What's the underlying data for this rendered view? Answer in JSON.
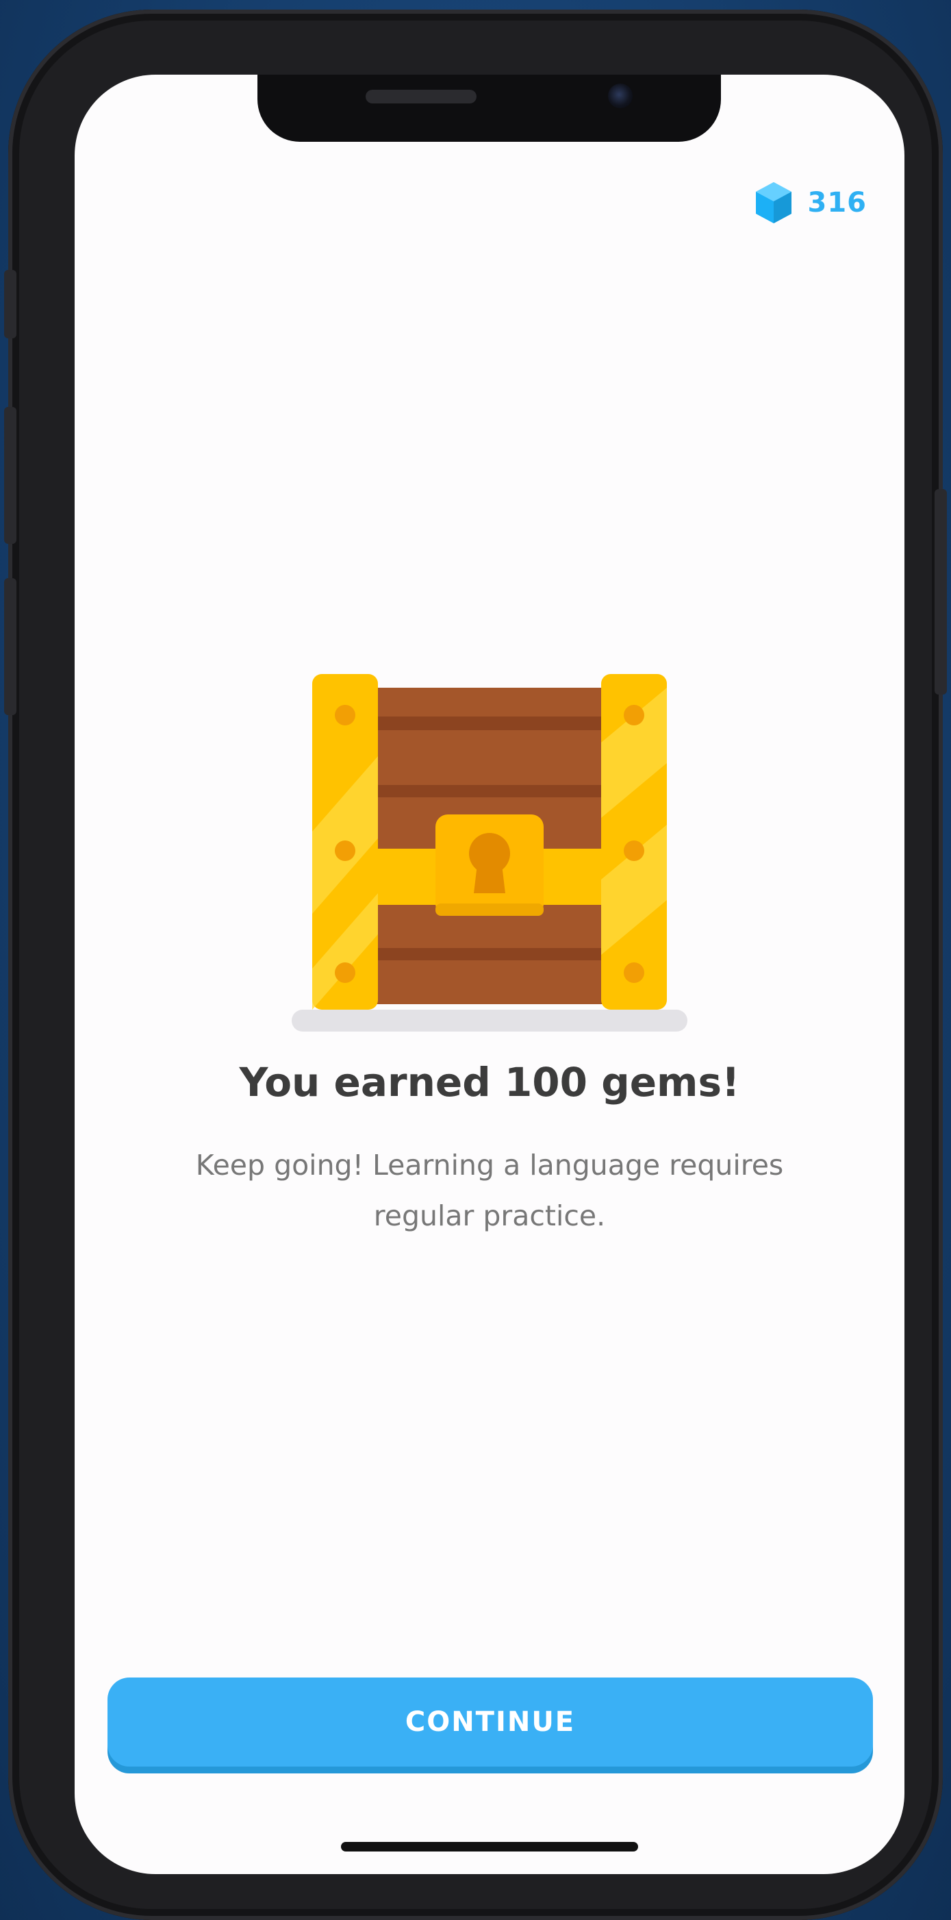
{
  "header": {
    "gem_count": "316",
    "gem_icon": "gem-icon"
  },
  "reward": {
    "illustration": "treasure-chest-icon",
    "title": "You earned 100 gems!",
    "message": "Keep going! Learning a language requires regular practice."
  },
  "footer": {
    "continue_label": "CONTINUE"
  },
  "colors": {
    "accent": "#3ab0f5",
    "gem": "#2fb0f3",
    "chest_gold": "#ffc200",
    "chest_wood": "#a4562a"
  }
}
